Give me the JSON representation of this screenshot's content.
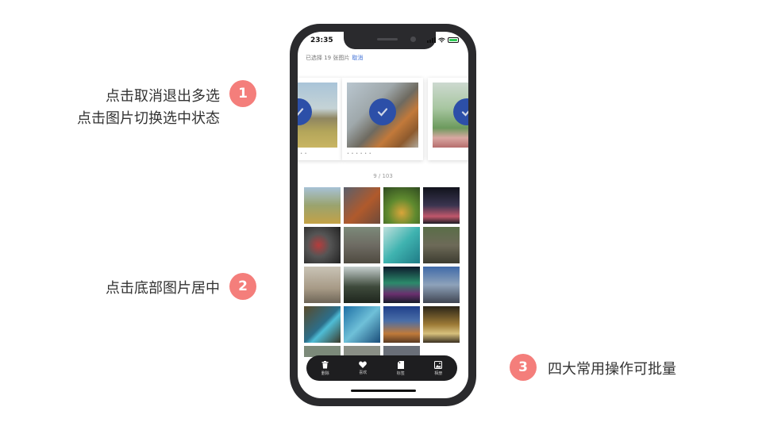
{
  "annotations": [
    {
      "number": "1",
      "lines": [
        "点击取消退出多选",
        "点击图片切换选中状态"
      ]
    },
    {
      "number": "2",
      "lines": [
        "点击底部图片居中"
      ]
    },
    {
      "number": "3",
      "lines": [
        "四大常用操作可批量"
      ]
    }
  ],
  "phone": {
    "status_time": "23:35",
    "selection": {
      "label": "已选择 19 张图片",
      "cancel": "取消"
    },
    "counter": "9 / 103",
    "actions": [
      {
        "icon": "trash-icon",
        "label": "删除"
      },
      {
        "icon": "heart-icon",
        "label": "喜欢"
      },
      {
        "icon": "tag-icon",
        "label": "标签"
      },
      {
        "icon": "album-icon",
        "label": "相册"
      }
    ]
  },
  "colors": {
    "badge": "#f47e7b",
    "check": "#2c4fa8",
    "cancel": "#3d6fd6"
  }
}
